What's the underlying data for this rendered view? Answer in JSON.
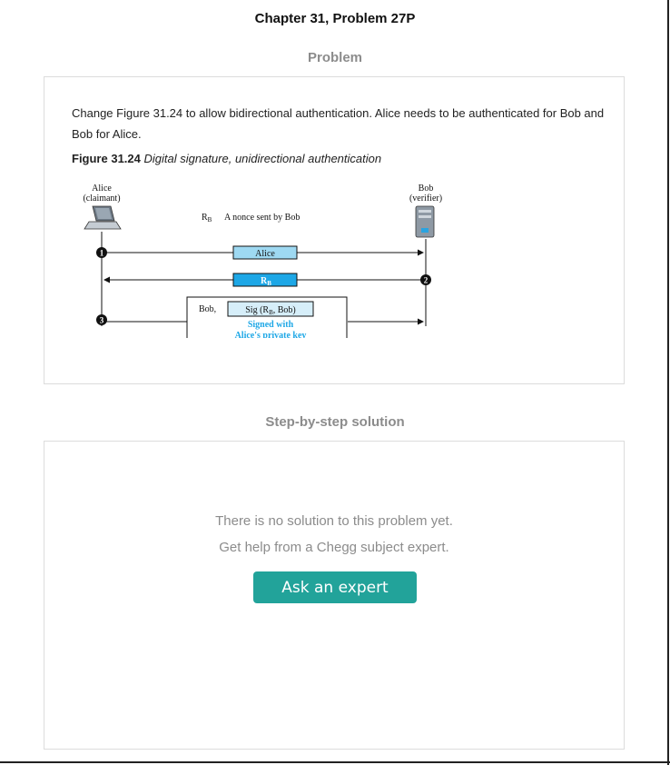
{
  "chapter_title": "Chapter 31, Problem 27P",
  "problem_section": {
    "heading": "Problem",
    "text": "Change Figure 31.24 to allow bidirectional authentication. Alice needs to be authenticated for Bob and Bob for Alice.",
    "figure_label": "Figure 31.24",
    "figure_title": "Digital signature, unidirectional authentication",
    "figure": {
      "left_party_name": "Alice",
      "left_party_role": "(claimant)",
      "right_party_name": "Bob",
      "right_party_role": "(verifier)",
      "nonce_symbol": "R",
      "nonce_sub": "B",
      "nonce_desc": "A nonce sent by Bob",
      "msg1_label": "Alice",
      "msg2_label": "R",
      "msg2_sub": "B",
      "msg3_prefix": "Bob,",
      "msg3_sig_a": "Sig (R",
      "msg3_sig_sub": "B",
      "msg3_sig_b": ", Bob)",
      "msg3_note_line1": "Signed with",
      "msg3_note_line2": "Alice's private key",
      "step1": "1",
      "step2": "2",
      "step3": "3"
    }
  },
  "solution_section": {
    "heading": "Step-by-step solution",
    "line1": "There is no solution to this problem yet.",
    "line2": "Get help from a Chegg subject expert.",
    "button_label": "Ask an expert"
  }
}
